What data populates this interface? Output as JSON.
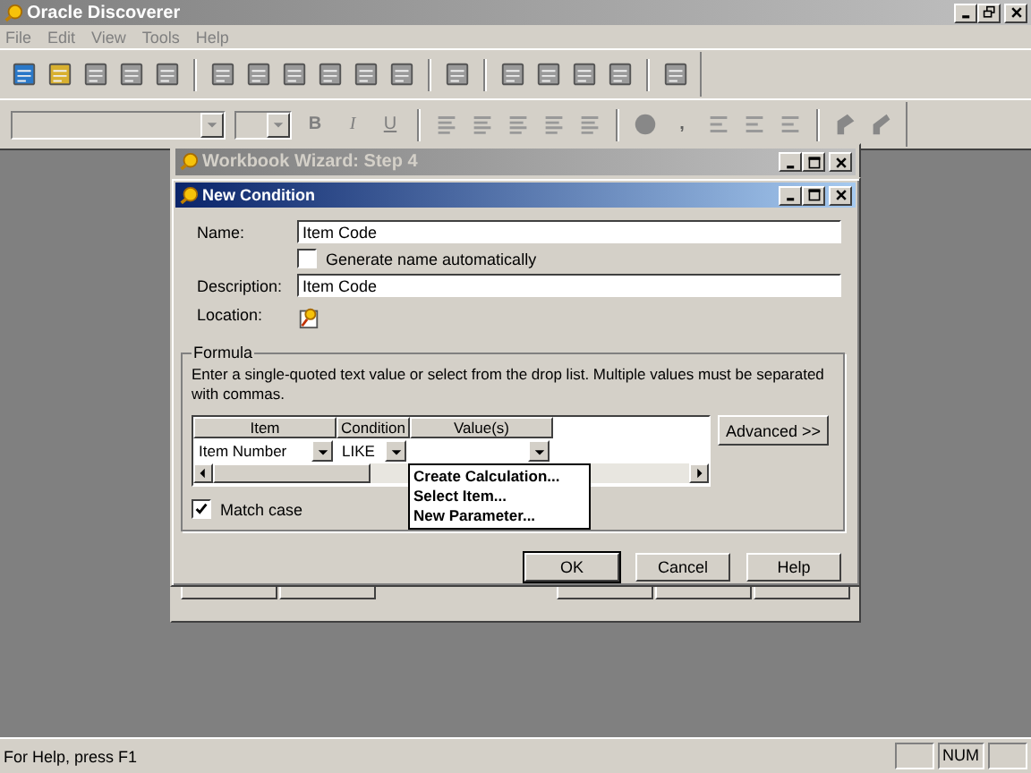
{
  "app": {
    "title": "Oracle Discoverer"
  },
  "menu": [
    {
      "label": "File",
      "disabled": true
    },
    {
      "label": "Edit",
      "disabled": true
    },
    {
      "label": "View",
      "disabled": true
    },
    {
      "label": "Tools",
      "disabled": true
    },
    {
      "label": "Help",
      "disabled": true
    }
  ],
  "format_toolbar": {
    "style_buttons": [
      {
        "label": "B",
        "kind": "bold"
      },
      {
        "label": "I",
        "kind": "italic"
      },
      {
        "label": "U",
        "kind": "underline"
      }
    ],
    "comma_button": ","
  },
  "wizard": {
    "title": "Workbook Wizard: Step 4"
  },
  "dialog": {
    "title": "New Condition",
    "name": {
      "label": "Name:",
      "value": "Item Code"
    },
    "generate_checkbox": {
      "label": "Generate name automatically",
      "checked": false
    },
    "description": {
      "label": "Description:",
      "value": "Item Code"
    },
    "location": {
      "label": "Location:"
    },
    "formula": {
      "title": "Formula",
      "instructions": "Enter a single-quoted text value or select from the drop list.  Multiple values must be separated with commas.",
      "columns": [
        "Item",
        "Condition",
        "Value(s)"
      ],
      "row": {
        "item": "Item Number",
        "condition": "LIKE"
      },
      "advanced_button": "Advanced >>",
      "dropdown_menu": [
        "Create Calculation...",
        "Select Item...",
        "New Parameter..."
      ],
      "match_case": {
        "label": "Match case",
        "checked": true
      }
    },
    "buttons": [
      {
        "label": "OK",
        "default": true
      },
      {
        "label": "Cancel",
        "default": false
      },
      {
        "label": "Help",
        "default": false
      }
    ]
  },
  "status_bar": {
    "text": "For Help, press F1",
    "indicators": [
      "NUM"
    ]
  }
}
